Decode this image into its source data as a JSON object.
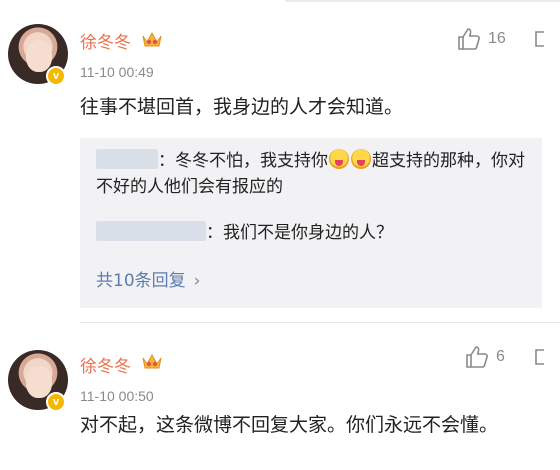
{
  "comments": [
    {
      "username": "徐冬冬",
      "time": "11-10 00:49",
      "likes": "16",
      "content": "往事不堪回首，我身边的人才会知道。",
      "replies": [
        {
          "text_before": "：冬冬不怕，我支持你",
          "text_after": "超支持的那种，你对不好的人他们会有报应的"
        },
        {
          "text": "：我们不是你身边的人？"
        }
      ],
      "reply_count_label": "共10条回复",
      "reply_chevron": "›"
    },
    {
      "username": "徐冬冬",
      "time": "11-10 00:50",
      "likes": "6",
      "content": "对不起，这条微博不回复大家。你们永远不会懂。"
    }
  ],
  "badge_letter": "v",
  "colors": {
    "username": "#eb7350",
    "link": "#5e7cae",
    "meta": "#8a8a8a",
    "reply_bg": "#f2f2f5",
    "verified": "#f5b800"
  },
  "icons": [
    "avatar",
    "verified-badge-icon",
    "crown-badge-icon",
    "thumbs-up-icon",
    "more-icon",
    "tongue-emoji-icon",
    "chevron-right-icon"
  ]
}
